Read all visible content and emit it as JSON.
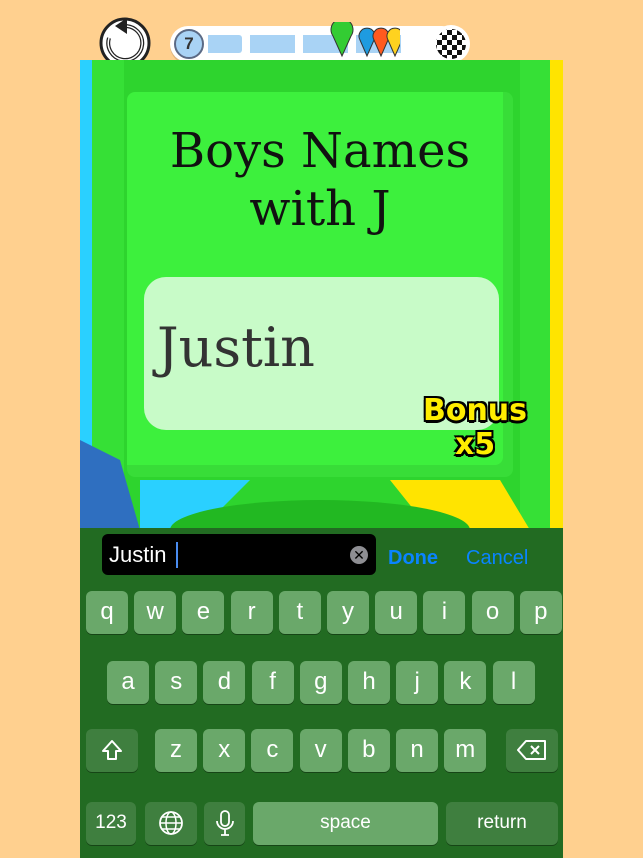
{
  "hud": {
    "restart_icon": "restart-arrow-icon",
    "level": "7",
    "finish_icon": "checkered-flag-icon",
    "pin_colors": [
      "#33cc33",
      "#1e9be0",
      "#ff5a1f",
      "#ffd21f"
    ]
  },
  "board": {
    "title_line1": "Boys Names",
    "title_line2": "with J",
    "answer": "Justin",
    "bonus_line1": "Bonus",
    "bonus_line2": "x5"
  },
  "input_bar": {
    "value": "Justin",
    "clear_icon": "clear-x-icon",
    "done_label": "Done",
    "cancel_label": "Cancel"
  },
  "keyboard": {
    "row1": [
      "q",
      "w",
      "e",
      "r",
      "t",
      "y",
      "u",
      "i",
      "o",
      "p"
    ],
    "row2": [
      "a",
      "s",
      "d",
      "f",
      "g",
      "h",
      "j",
      "k",
      "l"
    ],
    "row3": [
      "z",
      "x",
      "c",
      "v",
      "b",
      "n",
      "m"
    ],
    "shift_icon": "shift-arrow-icon",
    "backspace_icon": "backspace-icon",
    "numbers_label": "123",
    "globe_icon": "globe-icon",
    "mic_icon": "microphone-icon",
    "space_label": "space",
    "return_label": "return"
  },
  "colors": {
    "background": "#ffd08f",
    "board_green": "#3df03d",
    "answer_box": "#c8fbc8",
    "keyboard_bg": "#226b22",
    "key": "#6aa86a",
    "accent_blue": "#0a84ff",
    "bonus_yellow": "#ffee00"
  }
}
